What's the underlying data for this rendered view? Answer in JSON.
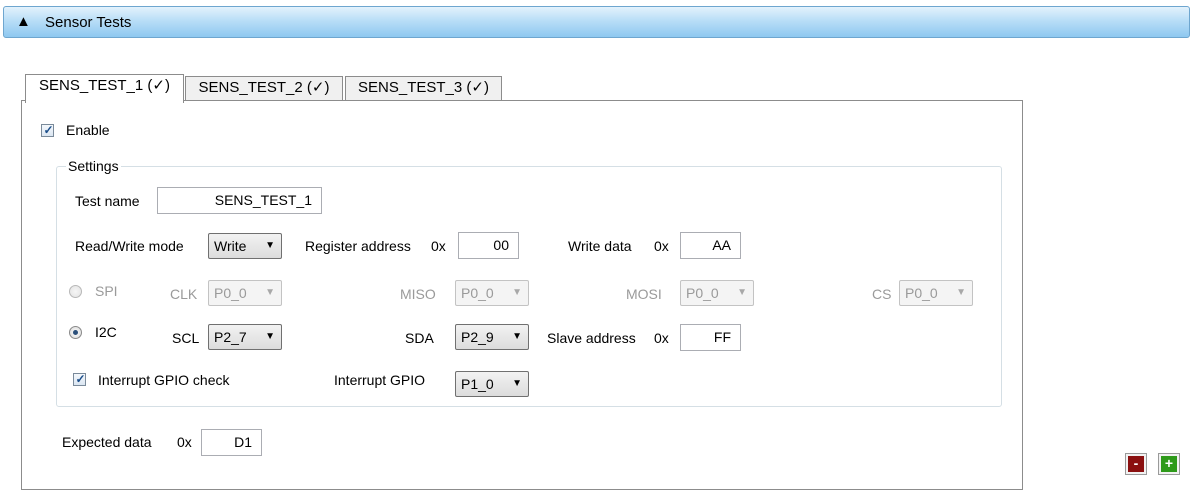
{
  "section": {
    "toggle_icon": "▲",
    "title": "Sensor Tests"
  },
  "tabs": [
    {
      "label": "SENS_TEST_1 (✓)",
      "active": true
    },
    {
      "label": "SENS_TEST_2 (✓)",
      "active": false
    },
    {
      "label": "SENS_TEST_3 (✓)",
      "active": false
    }
  ],
  "enable": {
    "label": "Enable",
    "checked": true
  },
  "settings": {
    "legend": "Settings",
    "test_name": {
      "label": "Test name",
      "value": "SENS_TEST_1"
    },
    "rw_mode": {
      "label": "Read/Write mode",
      "value": "Write"
    },
    "register_address": {
      "label": "Register address",
      "prefix": "0x",
      "value": "00"
    },
    "write_data": {
      "label": "Write data",
      "prefix": "0x",
      "value": "AA"
    },
    "spi": {
      "label": "SPI",
      "selected": false,
      "clk": {
        "label": "CLK",
        "value": "P0_0"
      },
      "miso": {
        "label": "MISO",
        "value": "P0_0"
      },
      "mosi": {
        "label": "MOSI",
        "value": "P0_0"
      },
      "cs": {
        "label": "CS",
        "value": "P0_0"
      }
    },
    "i2c": {
      "label": "I2C",
      "selected": true,
      "scl": {
        "label": "SCL",
        "value": "P2_7"
      },
      "sda": {
        "label": "SDA",
        "value": "P2_9"
      },
      "slave_address": {
        "label": "Slave address",
        "prefix": "0x",
        "value": "FF"
      }
    },
    "interrupt_check": {
      "label": "Interrupt GPIO check",
      "checked": true
    },
    "interrupt_gpio": {
      "label": "Interrupt GPIO",
      "value": "P1_0"
    }
  },
  "expected_data": {
    "label": "Expected data",
    "prefix": "0x",
    "value": "D1"
  },
  "buttons": {
    "remove": "-",
    "add": "+"
  },
  "colors": {
    "header_gradient_top": "#e3f2fc",
    "header_gradient_bottom": "#8ec8f0",
    "remove_button": "#8b1010",
    "add_button": "#2e9a1a",
    "check_mark": "#1b4e8a"
  },
  "icons": {
    "toggle": "collapse-triangle-icon",
    "check": "checkmark-icon",
    "dropdown": "chevron-down-icon"
  }
}
